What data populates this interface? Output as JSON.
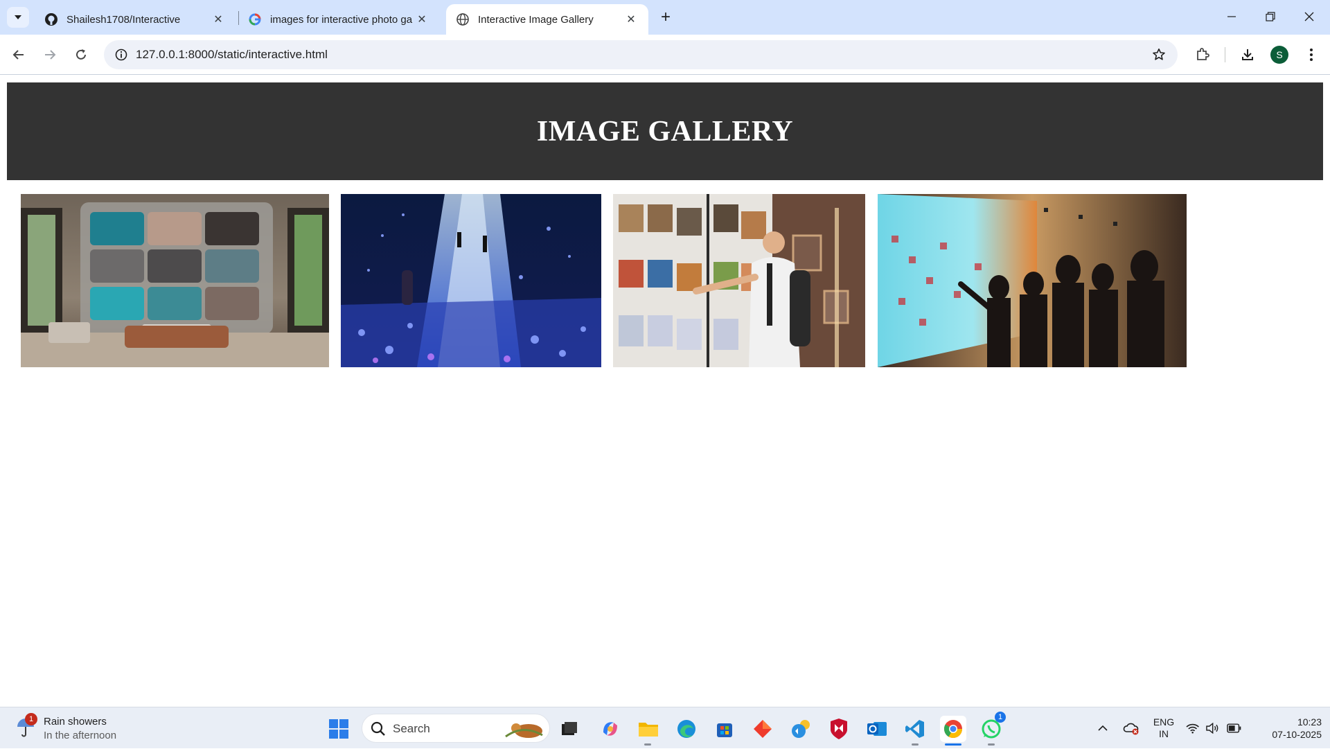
{
  "browser": {
    "tabs": [
      {
        "title": "Shailesh1708/Interactive",
        "favicon": "github-icon",
        "active": false
      },
      {
        "title": "images for interactive photo ga",
        "favicon": "google-icon",
        "active": false
      },
      {
        "title": "Interactive Image Gallery",
        "favicon": "globe-icon",
        "active": true
      }
    ],
    "address": "127.0.0.1:8000/static/interactive.html",
    "profile_initial": "S"
  },
  "page": {
    "header_title": "IMAGE GALLERY",
    "gallery": [
      {
        "name": "gallery-image-1",
        "subject": "living room with large photo wall"
      },
      {
        "name": "gallery-image-2",
        "subject": "immersive light installation corridor"
      },
      {
        "name": "gallery-image-3",
        "subject": "man touching interactive art wall"
      },
      {
        "name": "gallery-image-4",
        "subject": "people viewing digital display wall"
      }
    ]
  },
  "taskbar": {
    "weather_title": "Rain showers",
    "weather_sub": "In the afternoon",
    "weather_badge": "1",
    "search_placeholder": "Search",
    "whatsapp_badge": "1",
    "lang_1": "ENG",
    "lang_2": "IN",
    "time": "10:23",
    "date": "07-10-2025"
  },
  "colors": {
    "header_bg": "#333333",
    "tabstrip_bg": "#d3e3fd",
    "taskbar_bg": "#e9eef6"
  }
}
